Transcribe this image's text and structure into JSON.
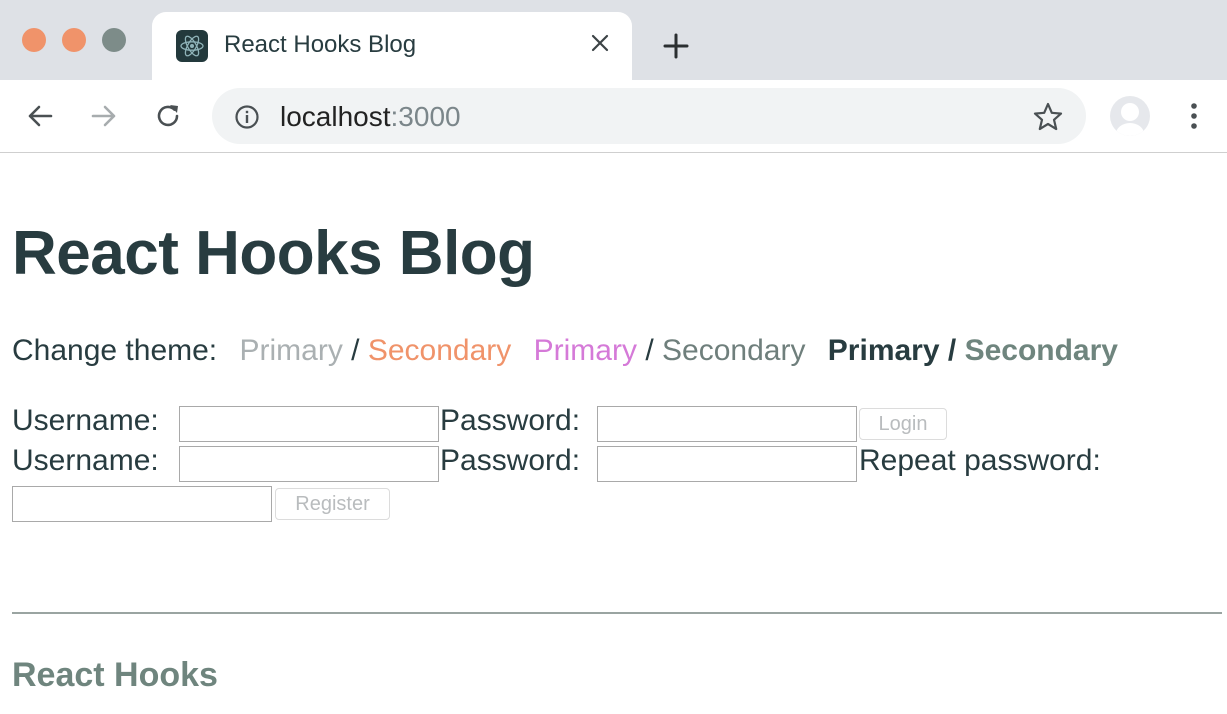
{
  "browser": {
    "tab_title": "React Hooks Blog",
    "url_host": "localhost",
    "url_port": ":3000",
    "icons": {
      "favicon": "react-logo-icon",
      "close": "close-icon",
      "new_tab": "plus-icon",
      "back": "arrow-left-icon",
      "forward": "arrow-right-icon",
      "reload": "reload-icon",
      "info": "info-icon",
      "bookmark": "star-icon",
      "profile": "avatar",
      "menu": "kebab-menu-icon"
    }
  },
  "page": {
    "title": "React Hooks Blog",
    "theme": {
      "label": "Change theme:",
      "separator": "/",
      "options": [
        {
          "primary": "Primary",
          "secondary": "Secondary",
          "primary_color": "#aab0b2",
          "secondary_color": "#f0936a"
        },
        {
          "primary": "Primary",
          "secondary": "Secondary",
          "primary_color": "#d57ad8",
          "secondary_color": "#6f7f7c"
        },
        {
          "primary": "Primary",
          "secondary": "Secondary",
          "primary_color": "#283c40",
          "secondary_color": "#6f857e"
        }
      ]
    },
    "login": {
      "username_label": "Username:",
      "password_label": "Password:",
      "username_value": "",
      "password_value": "",
      "submit_label": "Login"
    },
    "register": {
      "username_label": "Username:",
      "password_label": "Password:",
      "repeat_label": "Repeat password:",
      "username_value": "",
      "password_value": "",
      "repeat_value": "",
      "submit_label": "Register"
    },
    "footer_title": "React Hooks"
  }
}
